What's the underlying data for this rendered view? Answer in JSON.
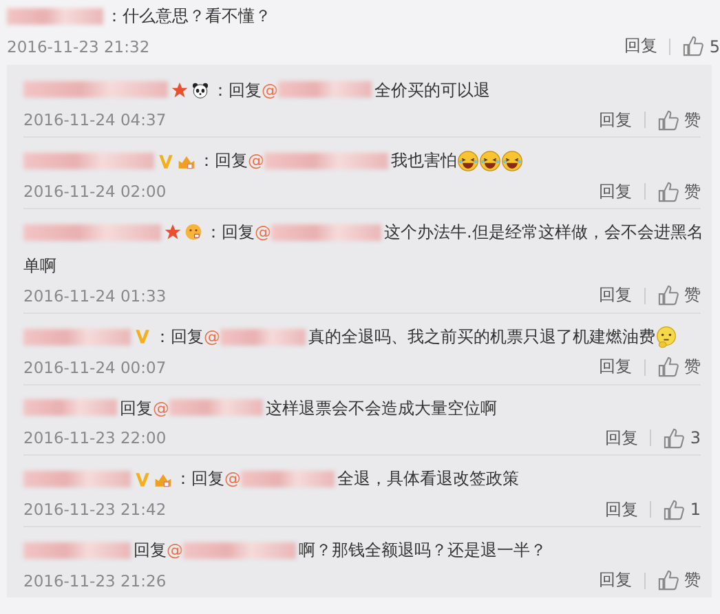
{
  "comment": {
    "text": "：什么意思？看不懂？",
    "time": "2016-11-23 21:32",
    "reply_label": "回复",
    "likes": "5"
  },
  "replies": [
    {
      "badges": [
        {
          "kind": "star"
        },
        {
          "kind": "panda"
        }
      ],
      "prefix": "：回复",
      "at": "@",
      "message": "全价买的可以退",
      "time": "2016-11-24 04:37",
      "reply_label": "回复",
      "likes": "赞"
    },
    {
      "badges": [
        {
          "kind": "v"
        },
        {
          "kind": "crown"
        }
      ],
      "prefix": "：回复",
      "at": "@",
      "message": "我也害怕",
      "emojis": [
        {
          "kind": "laugh"
        },
        {
          "kind": "laugh"
        },
        {
          "kind": "laugh"
        }
      ],
      "time": "2016-11-24 02:00",
      "reply_label": "回复",
      "likes": "赞"
    },
    {
      "badges": [
        {
          "kind": "star"
        },
        {
          "kind": "face"
        }
      ],
      "prefix": "：回复",
      "at": "@",
      "message": "这个办法牛.但是经常这样做，会不会进黑名",
      "message_wrap": "单啊",
      "time": "2016-11-24 01:33",
      "reply_label": "回复",
      "likes": "赞"
    },
    {
      "badges": [
        {
          "kind": "v"
        }
      ],
      "prefix": "：回复",
      "at": "@",
      "message": "真的全退吗、我之前买的机票只退了机建燃油费",
      "emojis": [
        {
          "kind": "think"
        }
      ],
      "time": "2016-11-24 00:07",
      "reply_label": "回复",
      "likes": "赞"
    },
    {
      "prefix": "回复",
      "at": "@",
      "message": "这样退票会不会造成大量空位啊",
      "time": "2016-11-23 22:00",
      "reply_label": "回复",
      "likes": "3"
    },
    {
      "badges": [
        {
          "kind": "v"
        },
        {
          "kind": "crown"
        }
      ],
      "prefix": "：回复",
      "at": "@",
      "message": "全退，具体看退改签政策",
      "time": "2016-11-23 21:42",
      "reply_label": "回复",
      "likes": "1"
    },
    {
      "prefix": "回复",
      "at": "@",
      "message": "啊？那钱全额退吗？还是退一半？",
      "time": "2016-11-23 21:26",
      "reply_label": "回复",
      "likes": "赞"
    }
  ]
}
